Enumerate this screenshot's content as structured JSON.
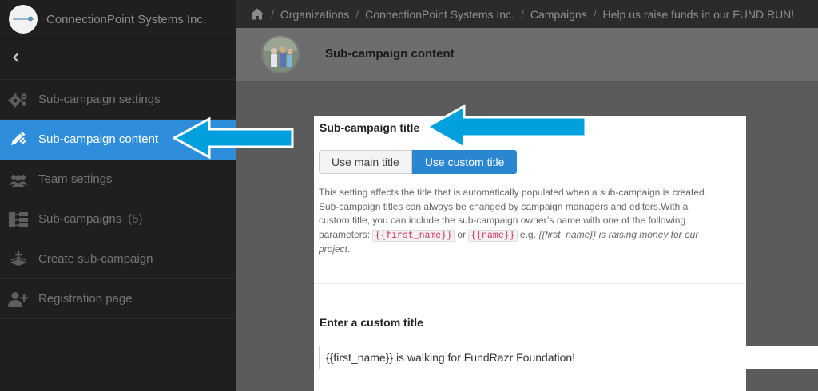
{
  "org": {
    "name": "ConnectionPoint Systems Inc.",
    "logo_icon": "org-logo-icon"
  },
  "breadcrumbs": [
    {
      "label": "Organizations"
    },
    {
      "label": "ConnectionPoint Systems Inc."
    },
    {
      "label": "Campaigns"
    },
    {
      "label": "Help us raise funds in our FUND RUN!"
    }
  ],
  "sidebar": {
    "back_icon": "chevron-left-icon",
    "items": [
      {
        "label": "Sub-campaign settings",
        "icon": "gears-icon"
      },
      {
        "label": "Sub-campaign content",
        "icon": "pencil-icon",
        "active": true
      },
      {
        "label": "Team settings",
        "icon": "team-icon"
      },
      {
        "label": "Sub-campaigns",
        "count": "(5)",
        "icon": "hierarchy-icon"
      },
      {
        "label": "Create sub-campaign",
        "icon": "add-layers-icon"
      },
      {
        "label": "Registration page",
        "icon": "user-plus-icon"
      }
    ]
  },
  "header": {
    "title": "Sub-campaign content"
  },
  "content": {
    "section_title": "Sub-campaign title",
    "options": [
      {
        "label": "Use main title",
        "selected": false
      },
      {
        "label": "Use custom title",
        "selected": true
      }
    ],
    "help": {
      "text_1": "This setting affects the title that is automatically populated when a sub-campaign is created. Sub-campaign titles can always be changed by campaign managers and editors.With a custom title, you can include the sub-campaign owner’s name with one of the following parameters: ",
      "param_1": "{{first_name}}",
      "or": " or ",
      "param_2": "{{name}}",
      "eg": " e.g. ",
      "example": "{{first_name}} is raising money for our project",
      "end": "."
    },
    "custom_title_label": "Enter a custom title",
    "custom_title_value": "{{first_name}} is walking for FundRazr Foundation!"
  },
  "colors": {
    "active": "#2e8edc",
    "button_selected": "#2a86d1",
    "arrow": "#00a0de",
    "code_text": "#d12f5a"
  }
}
